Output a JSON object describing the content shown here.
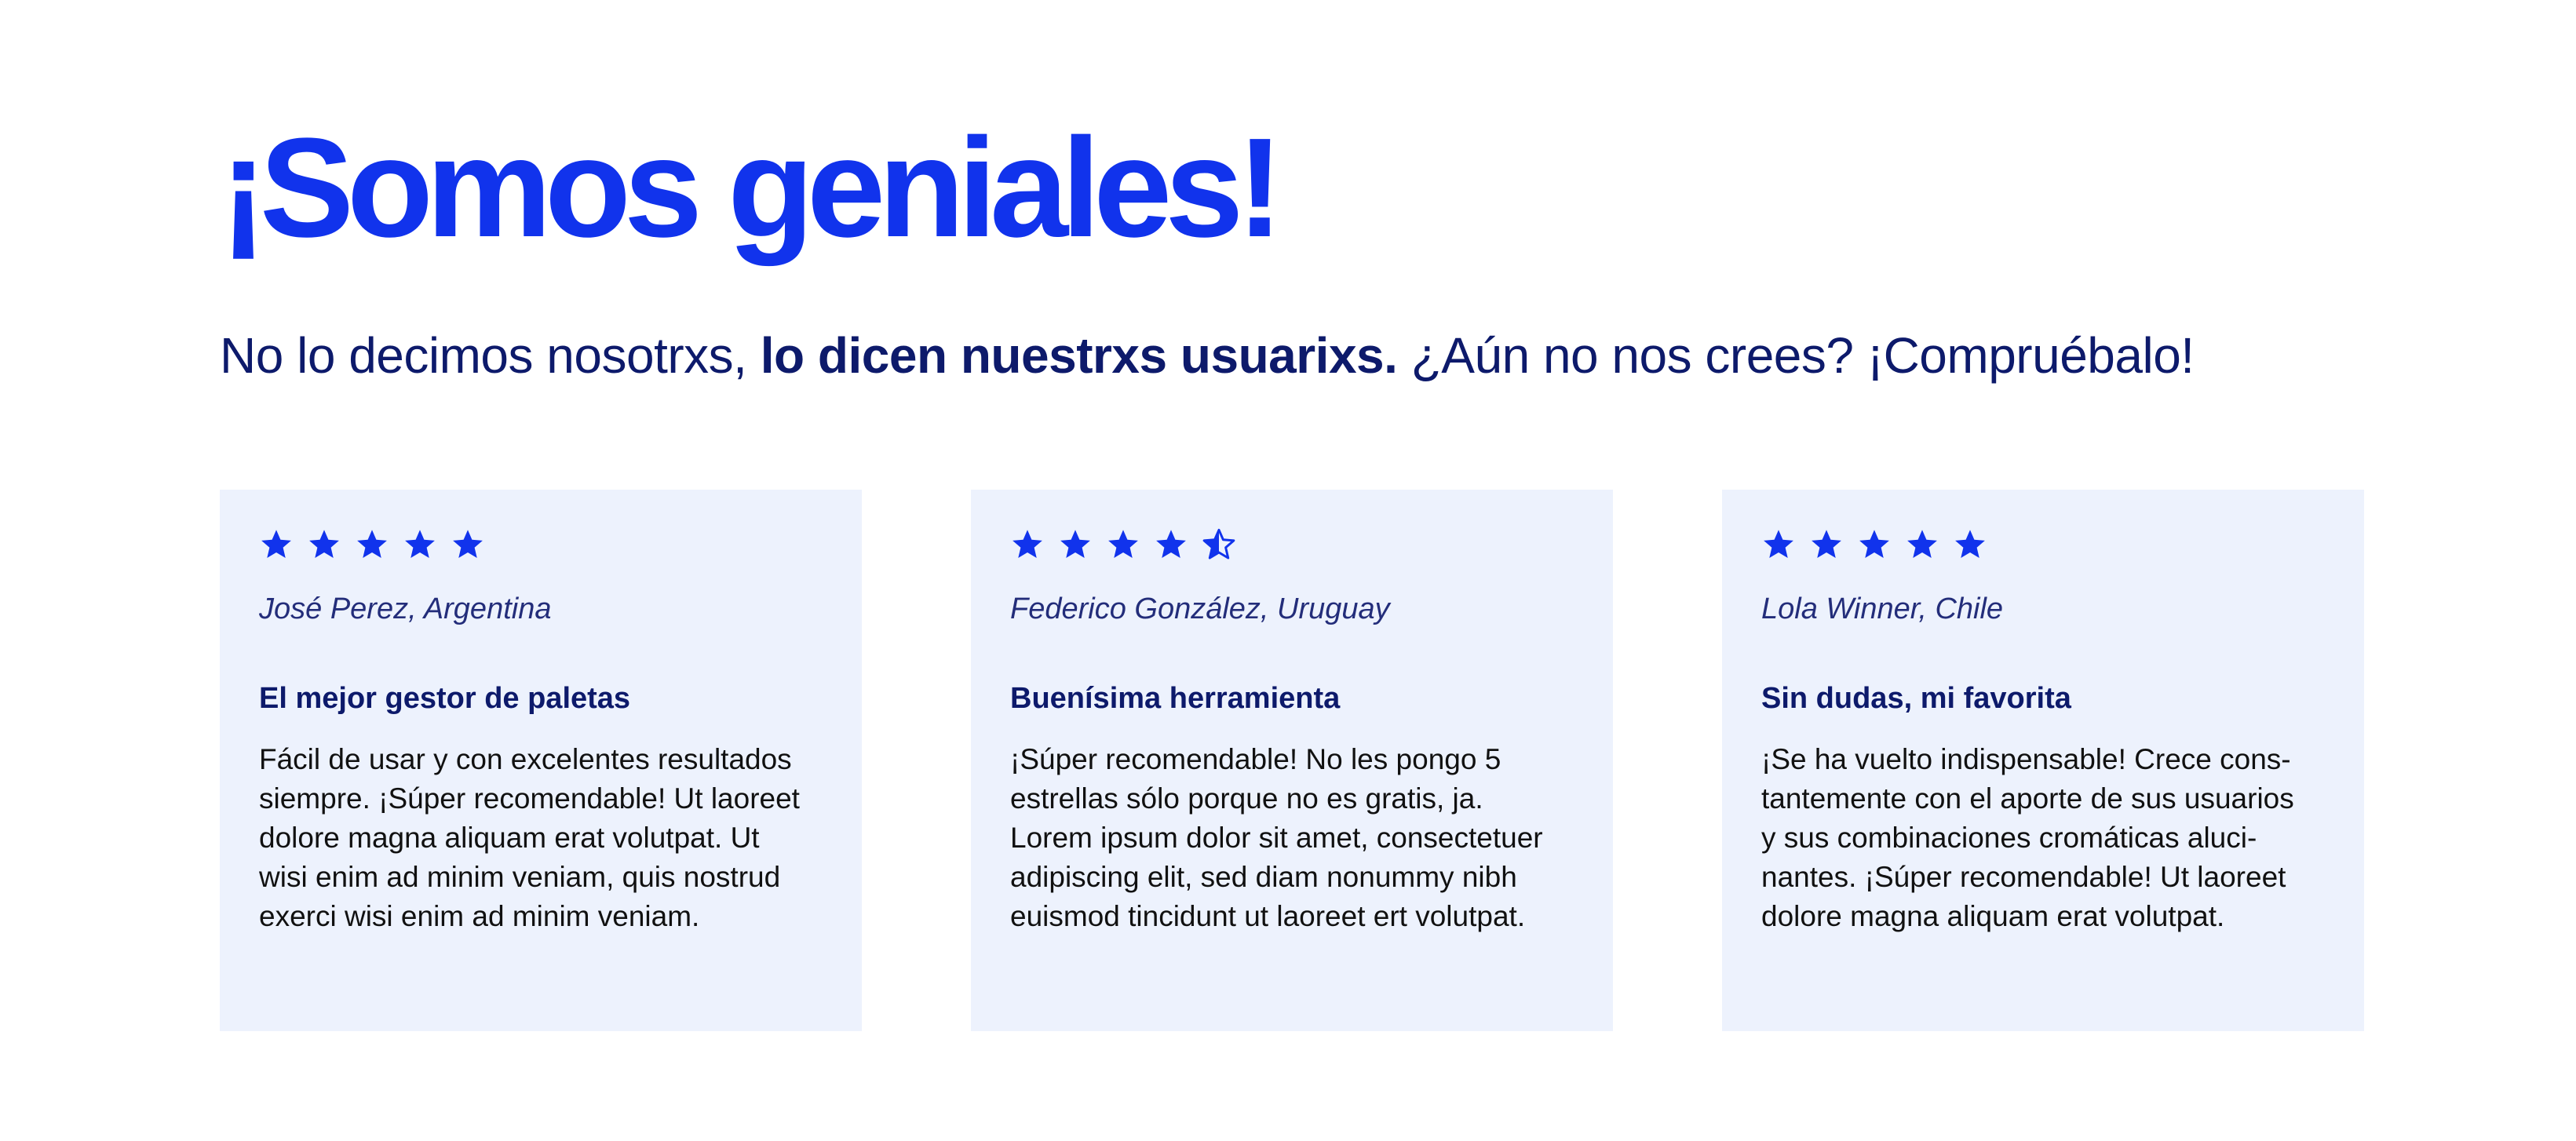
{
  "hero": {
    "title": "¡Somos geniales!",
    "subtitle_lead": "No lo decimos nosotrxs, ",
    "subtitle_bold": "lo dicen nuestrxs usuarixs.",
    "subtitle_tail": " ¿Aún no nos crees? ¡Compruébalo!"
  },
  "colors": {
    "accent": "#1133ec",
    "dark_text": "#0d1a6b",
    "card_bg": "#edf2fd"
  },
  "reviews": [
    {
      "rating": 5,
      "author": "José Perez, Argentina",
      "title": "El mejor gestor de paletas",
      "body_lines": [
        "Fácil de usar y con excelentes resultados",
        "siempre. ¡Súper recomendable! Ut laoreet",
        "dolore magna aliquam erat volutpat. Ut",
        "wisi enim ad minim veniam, quis nostrud",
        "exerci wisi enim ad minim veniam."
      ]
    },
    {
      "rating": 4.5,
      "author": "Federico González, Uruguay",
      "title": "Buenísima herramienta",
      "body_lines": [
        "¡Súper recomendable!  No les pongo 5",
        "estrellas sólo porque no es gratis, ja.",
        "Lorem ipsum dolor sit amet, consectetuer",
        "adipiscing elit, sed diam nonummy nibh",
        "euismod tincidunt ut laoreet ert volutpat."
      ]
    },
    {
      "rating": 5,
      "author": "Lola Winner, Chile",
      "title": "Sin dudas, mi favorita",
      "body_lines": [
        "¡Se ha vuelto indispensable! Crece cons-",
        "tantemente con el aporte de sus usuarios",
        "y sus combinaciones cromáticas aluci-",
        "nantes. ¡Súper recomendable! Ut laoreet",
        "dolore magna aliquam erat volutpat."
      ]
    }
  ]
}
